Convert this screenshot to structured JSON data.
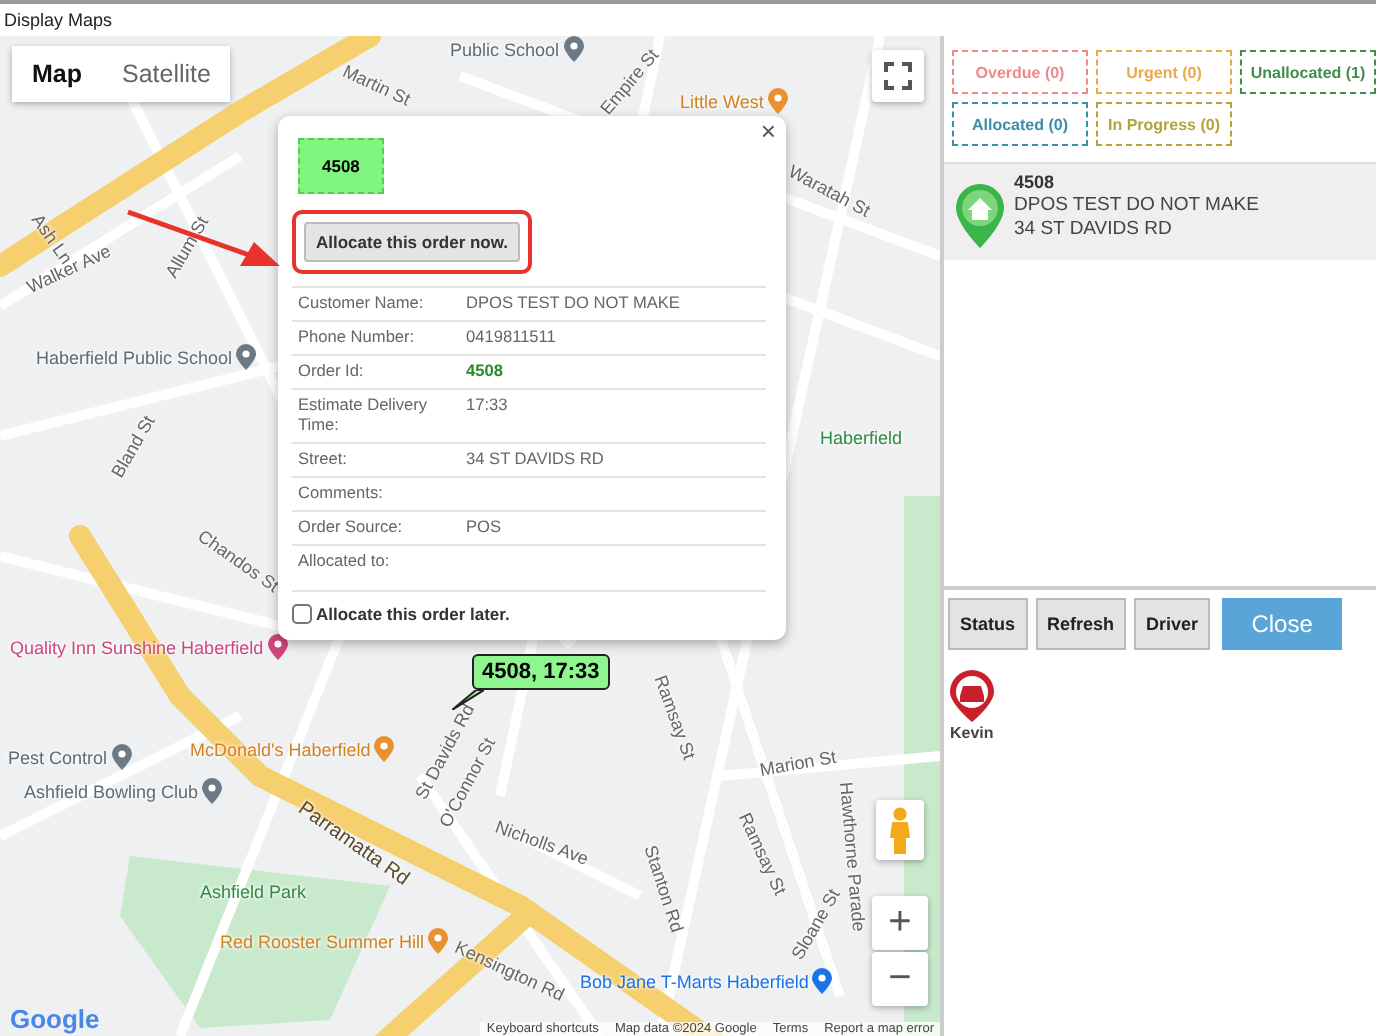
{
  "window": {
    "title": "Display Maps"
  },
  "map": {
    "type_tabs": [
      {
        "label": "Map",
        "selected": true
      },
      {
        "label": "Satellite",
        "selected": false
      }
    ],
    "labels": [
      {
        "text": "Martin St",
        "kind": "road"
      },
      {
        "text": "Empire St",
        "kind": "road"
      },
      {
        "text": "Public School",
        "kind": "poi"
      },
      {
        "text": "Little West",
        "kind": "food"
      },
      {
        "text": "Waratah St",
        "kind": "road"
      },
      {
        "text": "Ash Ln",
        "kind": "road"
      },
      {
        "text": "Allum St",
        "kind": "road"
      },
      {
        "text": "Walker Ave",
        "kind": "road"
      },
      {
        "text": "Haberfield Public School",
        "kind": "poi"
      },
      {
        "text": "Bland St",
        "kind": "road"
      },
      {
        "text": "Haberfield",
        "kind": "park"
      },
      {
        "text": "Chandos St",
        "kind": "road"
      },
      {
        "text": "Quality Inn Sunshine Haberfield",
        "kind": "hotel"
      },
      {
        "text": "Ramsay St",
        "kind": "road"
      },
      {
        "text": "Pest Control",
        "kind": "poi"
      },
      {
        "text": "McDonald's Haberfield",
        "kind": "food"
      },
      {
        "text": "Ashfield Bowling Club",
        "kind": "poi"
      },
      {
        "text": "Parramatta Rd",
        "kind": "major"
      },
      {
        "text": "St Davids Rd",
        "kind": "road"
      },
      {
        "text": "O'Connor St",
        "kind": "road"
      },
      {
        "text": "Nicholls Ave",
        "kind": "road"
      },
      {
        "text": "Stanton Rd",
        "kind": "road"
      },
      {
        "text": "Marion St",
        "kind": "road"
      },
      {
        "text": "Ramsay St",
        "kind": "road"
      },
      {
        "text": "Ashfield Park",
        "kind": "park"
      },
      {
        "text": "Red Rooster Summer Hill",
        "kind": "food"
      },
      {
        "text": "Sloane St",
        "kind": "road"
      },
      {
        "text": "Bob Jane T-Marts Haberfield",
        "kind": "shop"
      },
      {
        "text": "Kensington Rd",
        "kind": "road"
      },
      {
        "text": "Hawthorne Parade",
        "kind": "road"
      }
    ],
    "marker_label": "4508, 17:33",
    "zoom_in": "+",
    "zoom_out": "−",
    "logo": "Google",
    "footer": [
      "Keyboard shortcuts",
      "Map data ©2024 Google",
      "Terms",
      "Report a map error"
    ]
  },
  "popup": {
    "close": "×",
    "order_badge": "4508",
    "allocate_button": "Allocate this order now.",
    "highlighted": true,
    "fields": [
      {
        "label": "Customer Name:",
        "value": "DPOS TEST DO NOT MAKE",
        "emphasis": false
      },
      {
        "label": "Phone Number:",
        "value": "0419811511",
        "emphasis": false
      },
      {
        "label": "Order Id:",
        "value": "4508",
        "emphasis": true
      },
      {
        "label": "Estimate Delivery Time:",
        "value": "17:33",
        "emphasis": false
      },
      {
        "label": "Street:",
        "value": "34 ST DAVIDS RD",
        "emphasis": false
      },
      {
        "label": "Comments:"
      },
      {
        "label": "Order Source:",
        "value": "POS",
        "emphasis": false
      },
      {
        "label": "Allocated to:"
      }
    ],
    "later": {
      "label": "Allocate this order later.",
      "checked": false
    }
  },
  "panel": {
    "filters": [
      {
        "label": "Overdue (0)",
        "color": "#f08a8a"
      },
      {
        "label": "Urgent (0)",
        "color": "#eba94a"
      },
      {
        "label": "Unallocated (1)",
        "color": "#3f8f4a"
      },
      {
        "label": "Allocated (0)",
        "color": "#3a8fa8"
      },
      {
        "label": "In Progress (0)",
        "color": "#b5a23a"
      }
    ],
    "orders": [
      {
        "id": "4508",
        "name": "DPOS TEST DO NOT MAKE",
        "street": "34 ST DAVIDS RD"
      }
    ],
    "buttons": [
      {
        "label": "Status",
        "kind": "plain"
      },
      {
        "label": "Refresh",
        "kind": "plain"
      },
      {
        "label": "Driver",
        "kind": "plain"
      },
      {
        "label": "Close",
        "kind": "primary"
      }
    ],
    "drivers": [
      {
        "name": "Kevin"
      }
    ]
  }
}
